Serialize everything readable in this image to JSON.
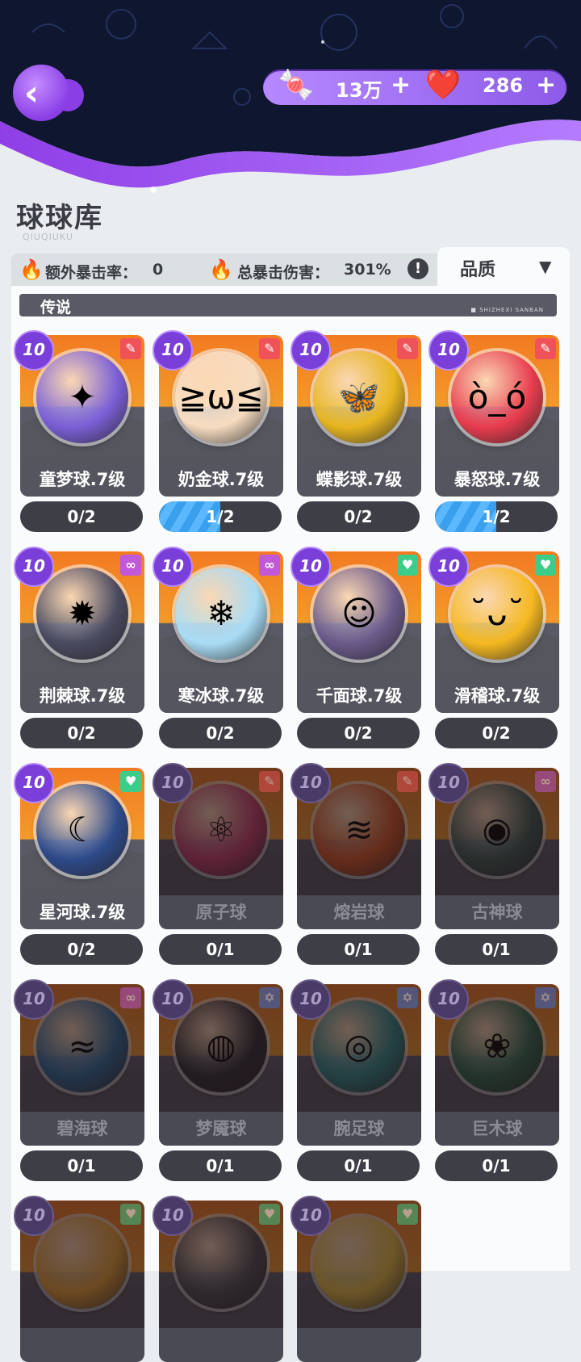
{
  "header": {
    "currency": [
      {
        "icon": "candy-icon",
        "value": "13万",
        "plus": "+"
      },
      {
        "icon": "heart-gem-icon",
        "value": "286",
        "plus": "+"
      }
    ]
  },
  "title": "球球库",
  "subtitle": "QIUQIUKU",
  "stats": {
    "crit_rate_label": "额外暴击率：",
    "crit_rate_value": "0",
    "crit_damage_label": "总暴击伤害：",
    "crit_damage_value": "301%",
    "info": "!"
  },
  "quality_filter": {
    "label": "品质",
    "arrow": "▼"
  },
  "section": {
    "label": "传说",
    "tag": "■ SHIZHEXI SANBAN"
  },
  "cards": [
    {
      "level": "10",
      "badge": "sword",
      "name": "童梦球.7级",
      "progress": "0/2",
      "fill": 0,
      "locked": false,
      "color": "#7a5fd6",
      "face": "✦"
    },
    {
      "level": "10",
      "badge": "sword",
      "name": "奶金球.7级",
      "progress": "1/2",
      "fill": 0.5,
      "locked": false,
      "color": "#f7dcc0",
      "face": "≧ω≦"
    },
    {
      "level": "10",
      "badge": "sword",
      "name": "蝶影球.7级",
      "progress": "0/2",
      "fill": 0,
      "locked": false,
      "color": "#e8b520",
      "face": "🦋"
    },
    {
      "level": "10",
      "badge": "sword",
      "name": "暴怒球.7级",
      "progress": "1/2",
      "fill": 0.5,
      "locked": false,
      "color": "#e83c4e",
      "face": "ò_ó"
    },
    {
      "level": "10",
      "badge": "chain",
      "name": "荆棘球.7级",
      "progress": "0/2",
      "fill": 0,
      "locked": false,
      "color": "#4a4a60",
      "face": "✹"
    },
    {
      "level": "10",
      "badge": "chain",
      "name": "寒冰球.7级",
      "progress": "0/2",
      "fill": 0,
      "locked": false,
      "color": "#a8dcf5",
      "face": "❄"
    },
    {
      "level": "10",
      "badge": "heart",
      "name": "千面球.7级",
      "progress": "0/2",
      "fill": 0,
      "locked": false,
      "color": "#6a5a8a",
      "face": "☺"
    },
    {
      "level": "10",
      "badge": "heart",
      "name": "滑稽球.7级",
      "progress": "0/2",
      "fill": 0,
      "locked": false,
      "color": "#f5b820",
      "face": "˘ᴗ˘"
    },
    {
      "level": "10",
      "badge": "heart",
      "name": "星河球.7级",
      "progress": "0/2",
      "fill": 0,
      "locked": false,
      "color": "#2e4a8a",
      "face": "☾"
    },
    {
      "level": "10",
      "badge": "sword",
      "name": "原子球",
      "progress": "0/1",
      "fill": 0,
      "locked": true,
      "color": "#c83a6a",
      "face": "⚛"
    },
    {
      "level": "10",
      "badge": "sword",
      "name": "熔岩球",
      "progress": "0/1",
      "fill": 0,
      "locked": true,
      "color": "#d8541e",
      "face": "≋"
    },
    {
      "level": "10",
      "badge": "chain",
      "name": "古神球",
      "progress": "0/1",
      "fill": 0,
      "locked": true,
      "color": "#3a5a50",
      "face": "◉"
    },
    {
      "level": "10",
      "badge": "chain",
      "name": "碧海球",
      "progress": "0/1",
      "fill": 0,
      "locked": true,
      "color": "#2a6a9a",
      "face": "≈"
    },
    {
      "level": "10",
      "badge": "star",
      "name": "梦魇球",
      "progress": "0/1",
      "fill": 0,
      "locked": true,
      "color": "#2a2a30",
      "face": "◍"
    },
    {
      "level": "10",
      "badge": "star",
      "name": "腕足球",
      "progress": "0/1",
      "fill": 0,
      "locked": true,
      "color": "#2a8a8a",
      "face": "◎"
    },
    {
      "level": "10",
      "badge": "star",
      "name": "巨木球",
      "progress": "0/1",
      "fill": 0,
      "locked": true,
      "color": "#2a6a4a",
      "face": "❀"
    },
    {
      "level": "10",
      "badge": "heart",
      "name": "",
      "progress": "",
      "fill": 0,
      "locked": true,
      "color": "#e8a030",
      "face": ""
    },
    {
      "level": "10",
      "badge": "heart",
      "name": "",
      "progress": "",
      "fill": 0,
      "locked": true,
      "color": "#4a4a50",
      "face": ""
    },
    {
      "level": "10",
      "badge": "heart",
      "name": "",
      "progress": "",
      "fill": 0,
      "locked": true,
      "color": "#e8c040",
      "face": ""
    }
  ]
}
